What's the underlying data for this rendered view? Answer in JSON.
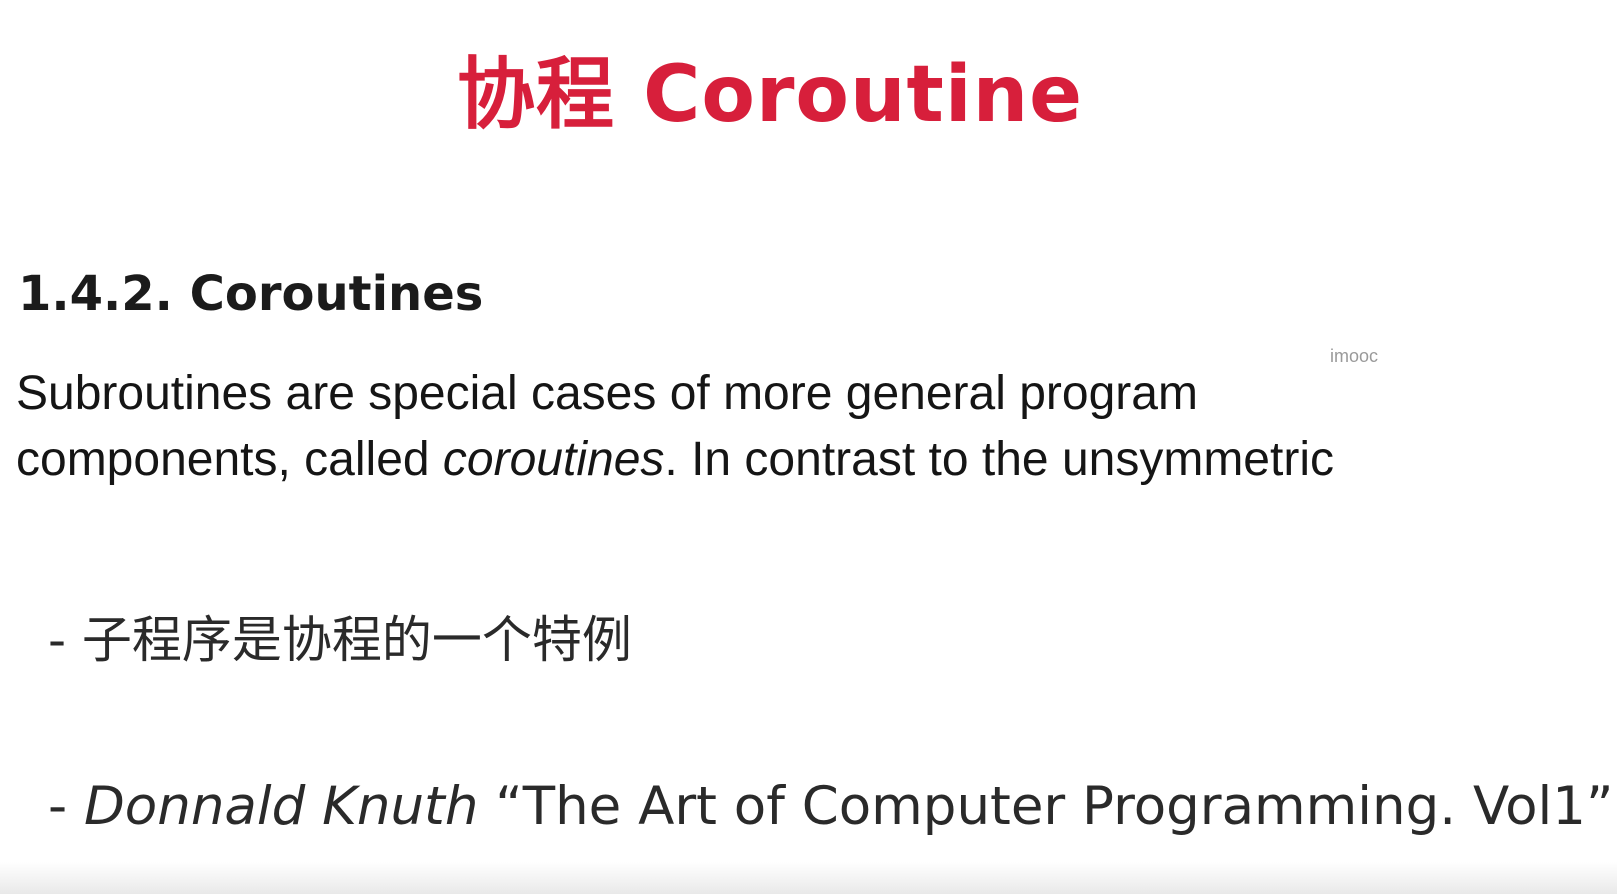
{
  "title": "协程 Coroutine",
  "section_heading": "1.4.2. Coroutines",
  "watermark": "imooc",
  "quote": {
    "line1": "Subroutines are special cases of more general program",
    "line2_before": "components, called ",
    "line2_emphasis": "coroutines",
    "line2_after": ". In contrast to the unsymmetric"
  },
  "bullets": {
    "first": "- 子程序是协程的一个特例",
    "second_dash": "- ",
    "second_author": "Donnald Knuth",
    "second_book": "   “The Art of Computer Programming. Vol1”"
  },
  "colors": {
    "title": "#d71f3b",
    "text": "#151515",
    "watermark": "#9a9a9a"
  }
}
